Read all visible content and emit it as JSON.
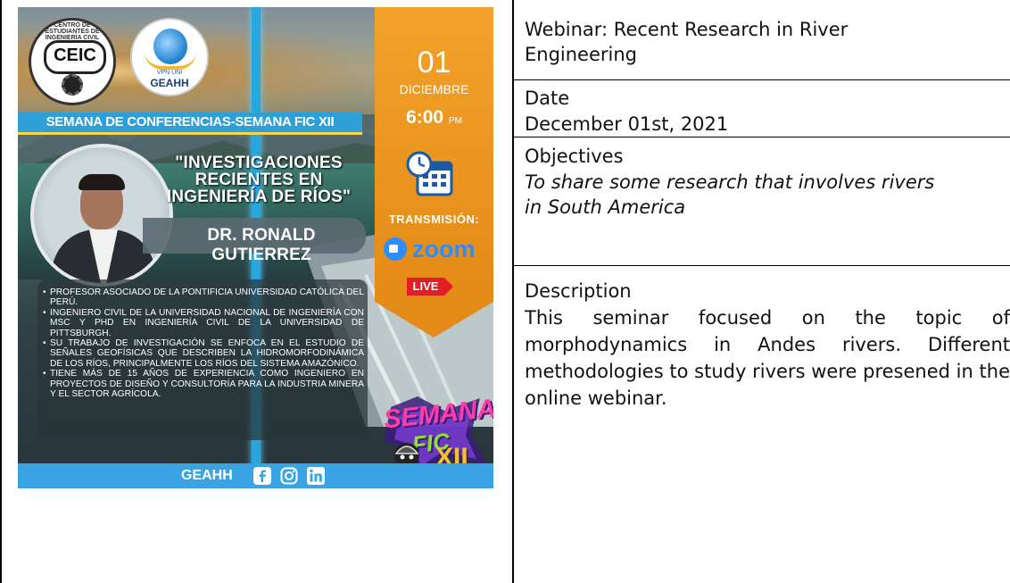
{
  "poster": {
    "logo_ceic": "CEIC",
    "logo_ceic_ring": "CENTRO DE ESTUDIANTES DE INGENIERÍA CIVIL",
    "logo_geahh_small": "VPN UNI",
    "logo_geahh_name": "GEAHH",
    "banner": "SEMANA DE CONFERENCIAS-SEMANA FIC XII",
    "day": "01",
    "month": "DICIEMBRE",
    "time": "6:00",
    "time_suffix": "PM",
    "talk_title_1": "\"INVESTIGACIONES",
    "talk_title_2": "RECIENTES EN",
    "talk_title_3": "INGENIERÍA DE RÍOS\"",
    "speaker": "DR. RONALD GUTIERREZ",
    "transmission_label": "TRANSMISIÓN:",
    "zoom_label": "zoom",
    "live_label": "LIVE",
    "bio": [
      "PROFESOR ASOCIADO DE LA PONTIFICIA UNIVERSIDAD CATÓLICA DEL PERÚ.",
      "INGENIERO CIVIL DE LA UNIVERSIDAD NACIONAL DE INGENIERÍA CON MSC Y PHD EN INGENIERÍA CIVIL DE LA UNIVERSIDAD DE PITTSBURGH.",
      "SU TRABAJO DE INVESTIGACIÓN SE ENFOCA EN EL ESTUDIO DE SEÑALES GEOFÍSICAS QUE DESCRIBEN LA HIDROMORFODINÁMICA DE LOS RÍOS, PRINCIPALMENTE LOS RÍOS DEL SISTEMA AMAZÓNICO.",
      "TIENE MÁS DE 15 AÑOS DE EXPERIENCIA COMO INGENIERO EN PROYECTOS DE DISEÑO  Y CONSULTORÍA PARA LA INDUSTRIA MINERA Y EL SECTOR AGRÍCOLA."
    ],
    "semana_fic_1": "SEMANA",
    "semana_fic_2": "FIC",
    "semana_fic_3": "XII",
    "footer": "GEAHH"
  },
  "cells": {
    "title": "Webinar: Recent Research in River Engineering",
    "date_label": "Date",
    "date_value": "December 01st, 2021",
    "objectives_label": "Objectives",
    "objectives_value": "To share some research that involves rivers in South America",
    "description_label": "Description",
    "description_value": "This seminar focused on the topic of morphodynamics in Andes rivers. Different methodologies to study rivers were presened in the online webinar."
  },
  "colors": {
    "border": "#000000",
    "text": "#111111",
    "poster_blue": "#2f9fd8",
    "poster_orange": "#e48a17",
    "live_red": "#e11d26",
    "zoom_blue": "#2d8cff"
  }
}
